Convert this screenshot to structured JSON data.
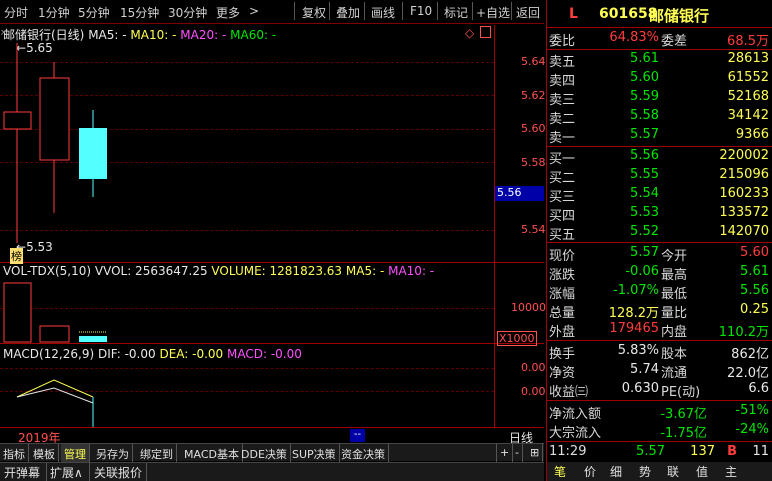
{
  "toolbar": {
    "left_items": [
      "分时",
      "1分钟",
      "5分钟",
      "15分钟",
      "30分钟",
      "更多"
    ],
    "more_arrow": ">",
    "right_items": [
      "复权",
      "叠加",
      "画线",
      "F10",
      "标记",
      "+自选",
      "返回"
    ]
  },
  "main_chart": {
    "title": "邮储银行(日线)",
    "ma5": "MA5: -",
    "ma10": "MA10: -",
    "ma20": "MA20: -",
    "ma60": "MA60: -",
    "high_label": "5.65",
    "low_label": "5.53",
    "price_ticks": [
      "5.64",
      "5.62",
      "5.60",
      "5.58",
      "5.56",
      "5.54"
    ],
    "current_price_tag": "5.56",
    "badge": "榜"
  },
  "volume_chart": {
    "title": "VOL-TDX(5,10)",
    "vvol": "VVOL: 2563647.25",
    "volume": "VOLUME: 1281823.63",
    "ma5": "MA5: -",
    "ma10": "MA10: -",
    "tick": "10000",
    "unit": "X1000"
  },
  "macd_chart": {
    "title": "MACD(12,26,9)",
    "dif": "DIF: -0.00",
    "dea": "DEA: -0.00",
    "macd": "MACD: -0.00",
    "ticks": [
      "0.00",
      "0.00"
    ]
  },
  "xaxis": {
    "year": "2019年",
    "period": "日线",
    "marker": "--"
  },
  "bottom_tabs": [
    "指标",
    "模板",
    "管理",
    "另存为",
    "绑定到",
    "MACD基本",
    "DDE决策",
    "SUP决策",
    "资金决策"
  ],
  "bottom_controls": [
    "+",
    "-",
    "⊞"
  ],
  "sub_tabs": [
    "开弹幕",
    "扩展∧",
    "关联报价"
  ],
  "quote": {
    "market": "L",
    "code": "601658",
    "name": "邮储银行",
    "weibi_label": "委比",
    "weibi": "64.83%",
    "weicha_label": "委差",
    "weicha": "68.5万",
    "asks": [
      {
        "label": "卖五",
        "price": "5.61",
        "vol": "28613"
      },
      {
        "label": "卖四",
        "price": "5.60",
        "vol": "61552"
      },
      {
        "label": "卖三",
        "price": "5.59",
        "vol": "52168"
      },
      {
        "label": "卖二",
        "price": "5.58",
        "vol": "34142"
      },
      {
        "label": "卖一",
        "price": "5.57",
        "vol": "9366"
      }
    ],
    "bids": [
      {
        "label": "买一",
        "price": "5.56",
        "vol": "220002"
      },
      {
        "label": "买二",
        "price": "5.55",
        "vol": "215096"
      },
      {
        "label": "买三",
        "price": "5.54",
        "vol": "160233"
      },
      {
        "label": "买四",
        "price": "5.53",
        "vol": "133572"
      },
      {
        "label": "买五",
        "price": "5.52",
        "vol": "142070"
      }
    ],
    "stats": [
      {
        "l1": "现价",
        "v1": "5.57",
        "l2": "今开",
        "v2": "5.60"
      },
      {
        "l1": "涨跌",
        "v1": "-0.06",
        "l2": "最高",
        "v2": "5.61"
      },
      {
        "l1": "涨幅",
        "v1": "-1.07%",
        "l2": "最低",
        "v2": "5.56"
      },
      {
        "l1": "总量",
        "v1": "128.2万",
        "l2": "量比",
        "v2": "0.25"
      },
      {
        "l1": "外盘",
        "v1": "179465",
        "l2": "内盘",
        "v2": "110.2万"
      }
    ],
    "fund": [
      {
        "l1": "换手",
        "v1": "5.83%",
        "l2": "股本",
        "v2": "862亿"
      },
      {
        "l1": "净资",
        "v1": "5.74",
        "l2": "流通",
        "v2": "22.0亿"
      },
      {
        "l1": "收益㈢",
        "v1": "0.630",
        "l2": "PE(动)",
        "v2": "6.6"
      }
    ],
    "flow": [
      {
        "l": "净流入额",
        "v": "-3.67亿",
        "p": "-51%"
      },
      {
        "l": "大宗流入",
        "v": "-1.75亿",
        "p": "-24%"
      }
    ],
    "tick": {
      "time": "11:29",
      "price": "5.57",
      "vol": "137",
      "side": "B",
      "count": "11"
    },
    "panel_tabs": [
      "笔",
      "价",
      "细",
      "势",
      "联",
      "值",
      "主"
    ]
  },
  "colors": {
    "up": "#ff3c3c",
    "down": "#54ffff",
    "fall": "#00e600",
    "grid": "#a00000"
  }
}
